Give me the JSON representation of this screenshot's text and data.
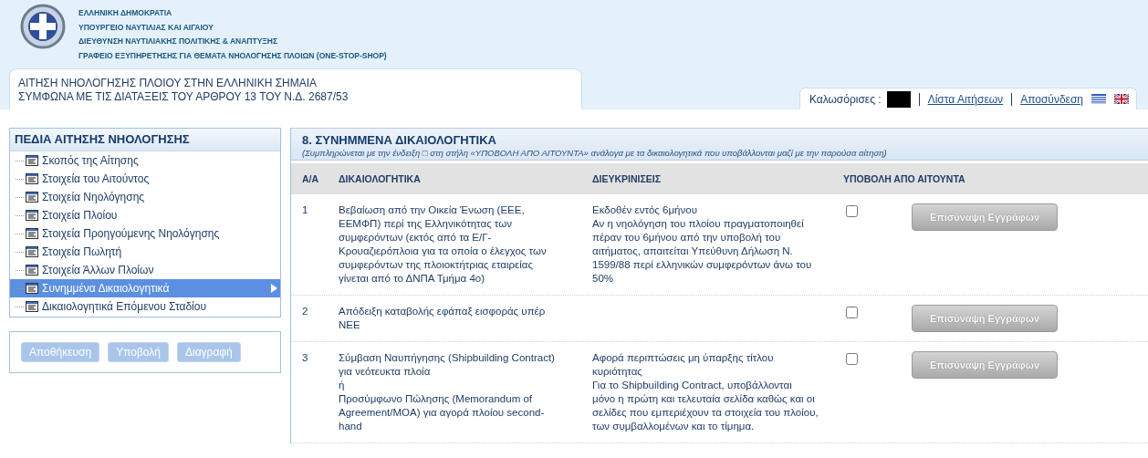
{
  "header": {
    "lines": [
      "ΕΛΛΗΝΙΚΗ ΔΗΜΟΚΡΑΤΙΑ",
      "ΥΠΟΥΡΓΕΙΟ ΝΑΥΤΙΛΙΑΣ ΚΑΙ ΑΙΓΑΙΟΥ",
      "ΔΙΕΥΘΥΝΣΗ ΝΑΥΤΙΛΙΑΚΗΣ ΠΟΛΙΤΙΚΗΣ & ΑΝΑΠΤΥΞΗΣ",
      "ΓΡΑΦΕΙΟ ΕΞΥΠΗΡΕΤΗΣΗΣ ΓΙΑ ΘΕΜΑΤΑ ΝΗΟΛΟΓΗΣΗΣ ΠΛΟΙΩΝ (ONE-STOP-SHOP)"
    ]
  },
  "page_title": [
    "ΑΙΤΗΣΗ ΝΗΟΛΟΓΗΣΗΣ ΠΛΟΙΟΥ ΣΤΗΝ ΕΛΛΗΝΙΚΗ ΣΗΜΑΙΑ",
    "ΣΥΜΦΩΝΑ ΜΕ ΤΙΣ ΔΙΑΤΑΞΕΙΣ ΤΟΥ ΑΡΘΡΟΥ 13 ΤΟΥ Ν.Δ. 2687/53"
  ],
  "user_bar": {
    "welcome": "Καλωσόρισες :",
    "links": [
      "Λίστα Αιτήσεων",
      "Αποσύνδεση"
    ]
  },
  "sidebar": {
    "title": "ΠΕΔΙΑ ΑΙΤΗΣΗΣ ΝΗΟΛΟΓΗΣΗΣ",
    "items": [
      {
        "label": "Σκοπός της Αίτησης",
        "selected": false
      },
      {
        "label": "Στοιχεία του Αιτούντος",
        "selected": false
      },
      {
        "label": "Στοιχεία Νηολόγησης",
        "selected": false
      },
      {
        "label": "Στοιχεία Πλοίου",
        "selected": false
      },
      {
        "label": "Στοιχεία Προηγούμενης Νηολόγησης",
        "selected": false
      },
      {
        "label": "Στοιχεία Πωλητή",
        "selected": false
      },
      {
        "label": "Στοιχεία Άλλων Πλοίων",
        "selected": false
      },
      {
        "label": "Συνημμένα Δικαιολογητικά",
        "selected": true
      },
      {
        "label": "Δικαιολογητικά Επόμενου Σταδίου",
        "selected": false
      }
    ],
    "buttons": [
      {
        "label": "Αποθήκευση",
        "disabled": true
      },
      {
        "label": "Υποβολή",
        "disabled": true
      },
      {
        "label": "Διαγραφή",
        "disabled": true
      }
    ]
  },
  "section": {
    "title": "8. ΣΥΝΗΜΜΕΝΑ ΔΙΚΑΙΟΛΟΓΗΤΙΚΑ",
    "note": "(Συμπληρώνεται με την ένδειξη □ στη στήλη «ΥΠΟΒΟΛΗ ΑΠΟ ΑΙΤΟΥΝΤΑ» ανάλογα με τα δικαιολογητικά που υποβάλλονται μαζί με την παρούσα αίτηση)"
  },
  "table": {
    "columns": [
      "Α/Α",
      "ΔΙΚΑΙΟΛΟΓΗΤΙΚΑ",
      "ΔΙΕΥΚΡΙΝΙΣΕΙΣ",
      "ΥΠΟΒΟΛΗ ΑΠΟ ΑΙΤΟΥΝΤΑ"
    ],
    "rows": [
      {
        "number": "1",
        "document": [
          "Βεβαίωση από την Οικεία Ένωση (ΕΕΕ,",
          "ΕΕΜΦΠ) περί της Ελληνικότητας των",
          "συμφερόντων (εκτός από τα Ε/Γ-",
          "Κρουαζιερόπλοια για τα οποία ο έλεγχος των",
          "συμφερόντων της πλοιοκτήτριας εταιρείας",
          "γίνεται από το ΔΝΠΑ Τμήμα 4ο)"
        ],
        "notes": [
          "Εκδοθέν εντός 6μήνου",
          "Αν η νηολόγηση του πλοίου πραγματοποιηθεί",
          "πέραν του 6μήνου από την υποβολή του",
          "αιτήματος, απαιτείται Υπεύθυνη Δήλωση Ν.",
          "1599/88 περί ελληνικών συμφερόντων άνω του",
          "50%"
        ],
        "checked": false,
        "button": "Επισύναψη Εγγράφων"
      },
      {
        "number": "2",
        "document": [
          "Απόδειξη καταβολής εφάπαξ εισφοράς υπέρ",
          "ΝΕΕ"
        ],
        "checked": false,
        "button": "Επισύναψη Εγγράφων"
      },
      {
        "number": "3",
        "document": [
          "Σύμβαση Ναυπήγησης (Shipbuilding Contract)",
          "για νεότευκτα πλοία",
          "ή",
          "Προσύμφωνο Πώλησης (Memorandum of",
          "Agreement/MOA) για αγορά πλοίου second-",
          "hand"
        ],
        "notes": [
          "Αφορά περιπτώσεις μη ύπαρξης τίτλου",
          "κυριότητας",
          "Για το Shipbuilding Contract, υποβάλλονται",
          "μόνο η πρώτη και τελευταία σελίδα καθώς και οι",
          "σελίδες που εμπεριέχουν τα στοιχεία του πλοίου,",
          "των συμβαλλομένων και το τίμημα."
        ],
        "checked": false,
        "button": "Επισύναψη Εγγράφων"
      }
    ]
  }
}
